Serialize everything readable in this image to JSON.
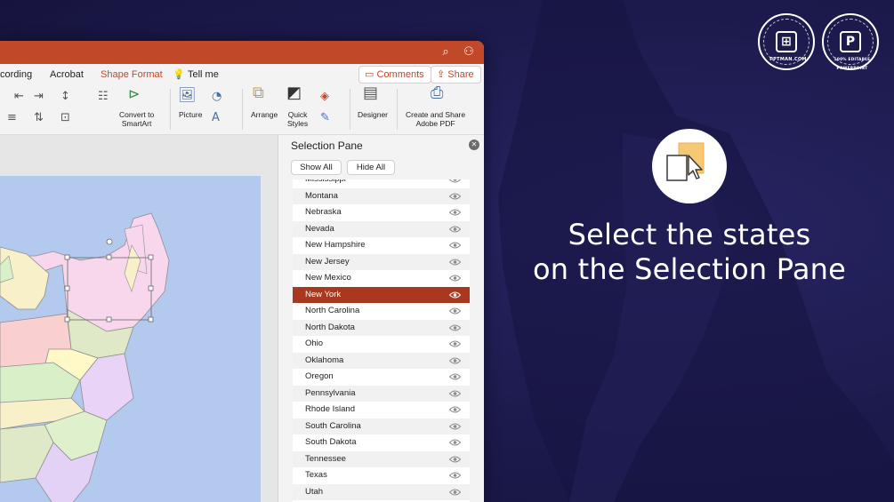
{
  "promo": {
    "headline_line1": "Select the states",
    "headline_line2": "on the Selection Pane",
    "badge_left_text": "PPTMAN.COM",
    "badge_right_text": "100% EDITABLE POWERPOINT",
    "badge_right_letter": "P"
  },
  "window": {
    "colors": {
      "accent": "#c2482a",
      "selected_row": "#a8391e",
      "map_water": "#b4c9ee"
    },
    "tabs": [
      "cording",
      "Acrobat",
      "Shape Format",
      "Tell me"
    ],
    "active_tab": "Shape Format",
    "comments_label": "Comments",
    "share_label": "Share",
    "ribbon": {
      "convert_smartart": "Convert to\nSmartArt",
      "picture": "Picture",
      "arrange": "Arrange",
      "quick_styles": "Quick\nStyles",
      "designer": "Designer",
      "adobe_pdf": "Create and Share\nAdobe PDF"
    }
  },
  "selection_pane": {
    "title": "Selection Pane",
    "show_all": "Show All",
    "hide_all": "Hide All",
    "items": [
      {
        "label": "Mississippi",
        "selected": false
      },
      {
        "label": "Montana",
        "selected": false
      },
      {
        "label": "Nebraska",
        "selected": false
      },
      {
        "label": "Nevada",
        "selected": false
      },
      {
        "label": "New Hampshire",
        "selected": false
      },
      {
        "label": "New Jersey",
        "selected": false
      },
      {
        "label": "New Mexico",
        "selected": false
      },
      {
        "label": "New York",
        "selected": true
      },
      {
        "label": "North Carolina",
        "selected": false
      },
      {
        "label": "North Dakota",
        "selected": false
      },
      {
        "label": "Ohio",
        "selected": false
      },
      {
        "label": "Oklahoma",
        "selected": false
      },
      {
        "label": "Oregon",
        "selected": false
      },
      {
        "label": "Pennsylvania",
        "selected": false
      },
      {
        "label": "Rhode Island",
        "selected": false
      },
      {
        "label": "South Carolina",
        "selected": false
      },
      {
        "label": "South Dakota",
        "selected": false
      },
      {
        "label": "Tennessee",
        "selected": false
      },
      {
        "label": "Texas",
        "selected": false
      },
      {
        "label": "Utah",
        "selected": false
      }
    ]
  }
}
